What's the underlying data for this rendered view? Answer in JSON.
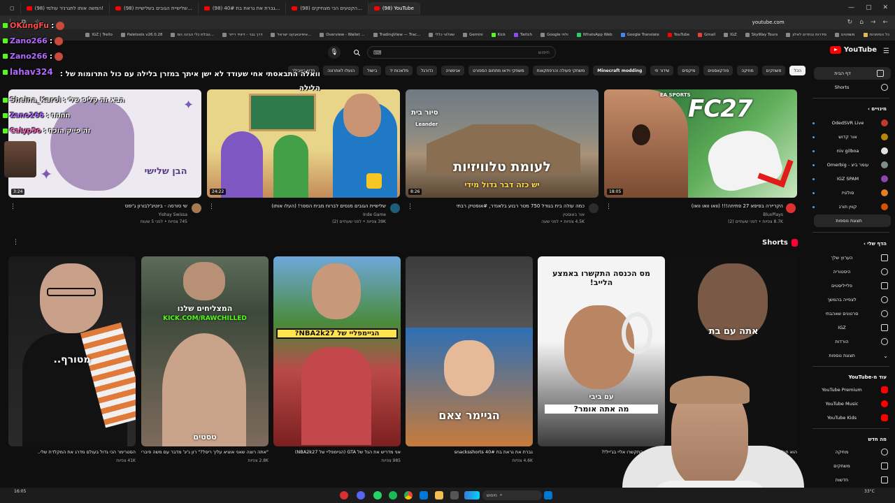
{
  "browser": {
    "tabs": [
      {
        "label": "(98) YouTube",
        "active": true
      },
      {
        "label": "(98) הקטעים הכי מצחיקים...",
        "active": false
      },
      {
        "label": "(98) גברת את גראת בת 40#...",
        "active": false
      },
      {
        "label": "(98) שלישיית הגובים בשלישיית...",
        "active": false
      },
      {
        "label": "(98) המשה אותו לתגרניר עולמי!",
        "active": false
      }
    ],
    "url": "youtube.com",
    "bookmarks": [
      "IGZ | Trello",
      "Paletools v26.0.28",
      "טבלת כלי הבינה המ...",
      "דרך גבר - דיוויד רייזר",
      "איפיונאגקט ישראל...",
      "Overview - Wallet ...",
      "TradingView — Trac...",
      "שאלוני כללי",
      "Gemini",
      "Kick",
      "Twitch",
      "Google ולתי",
      "WhatsApp Web",
      "Google Translate",
      "YouTube",
      "Gmail",
      "IGZ",
      "SkyWay Tours",
      "סידרות ובחדים לאלון",
      "משפטים",
      "כל הסימניות"
    ]
  },
  "header": {
    "search_placeholder": "חיפוש",
    "logo_text": "YouTube"
  },
  "chips": [
    "הכל",
    "משחקים",
    "מוזיקה",
    "פודקאסטים",
    "מיקסים",
    "שידור חי",
    "Minecraft modding",
    "משחקי פעולה והרפתקאות",
    "משחקי וידאו מתחום הספורט",
    "אנימציה",
    "כדורגל",
    "מלאכות יד",
    "בישול",
    "הועלו לאחרונה",
    "חדש בשבילך"
  ],
  "sidebar": {
    "main": [
      {
        "label": "דף הבית",
        "icon": "home-icon"
      },
      {
        "label": "Shorts",
        "icon": "shorts-icon"
      }
    ],
    "subscriptions_title": "מינויים",
    "subscriptions": [
      {
        "label": "OdedSVR Live",
        "color": "#c0392b",
        "live": true
      },
      {
        "label": "אור קדוש",
        "color": "#b8860b",
        "live": true
      },
      {
        "label": "niv gilboa",
        "color": "#e0e0e0",
        "live": true
      },
      {
        "label": "עומר ביצ - Omerbig",
        "color": "#7f8c8d",
        "live": true
      },
      {
        "label": "IGZ SPAM",
        "color": "#8e44ad",
        "live": true
      },
      {
        "label": "סולטיז",
        "color": "#e67e22",
        "live": true
      },
      {
        "label": "קווין תורג",
        "color": "#d35400",
        "live": true
      }
    ],
    "show_more_subs": "תצוגת נוספות",
    "you_title": "הדף שלי",
    "you_items": [
      {
        "label": "הערוץ שלך",
        "icon": "channel-icon"
      },
      {
        "label": "היסטוריה",
        "icon": "history-icon"
      },
      {
        "label": "פלייליסטים",
        "icon": "playlists-icon"
      },
      {
        "label": "לצפייה בהמשך",
        "icon": "watch-later-icon"
      },
      {
        "label": "סרטונים שאהבתי",
        "icon": "like-icon"
      },
      {
        "label": "IGZ",
        "icon": "playlist-icon"
      },
      {
        "label": "הורדות",
        "icon": "download-icon"
      },
      {
        "label": "תצוגת נוספות",
        "icon": "chevron-down-icon"
      }
    ],
    "more_title": "עוד מ-YouTube",
    "more_items": [
      {
        "label": "YouTube Premium"
      },
      {
        "label": "YouTube Music"
      },
      {
        "label": "YouTube Kids"
      }
    ],
    "explore_title": "מה חדש",
    "explore_items": [
      {
        "label": "מוזיקה"
      },
      {
        "label": "משחקים"
      },
      {
        "label": "חדשות"
      }
    ]
  },
  "videos": [
    {
      "title": "הקריירה בפיפא 27 פתיחה!!! (וואו וואו וואו)",
      "channel": "BluxPlays",
      "meta": "8.7K צפיות • לפני שעתיים (2)",
      "duration": "18:05",
      "overlay": "FC27",
      "overlay_small": "EA SPORTS"
    },
    {
      "title": "כמה עולה בית בגודל 750 מטר רבוע בלאנדר, #אופטיק רבתי",
      "channel": "אור באוסטין",
      "meta": "4.5K צפיות • לפני שעה",
      "duration": "8:26",
      "overlay": "לעומת טלוויזיות",
      "overlay2": "יש כזה דבר גדול מידי",
      "overlay3": "סיור בית",
      "overlay4": "Leander"
    },
    {
      "title": "שלישיית הגובים מנסים לברוח מבית הספר! (העלו אותו)",
      "channel": "Inde Game",
      "meta": "39K צפיות • לפני שעתיים (2)",
      "duration": "24:22"
    },
    {
      "title": "שי סורסה - ביוטיג'לבורון ג'ימס",
      "channel": "Yishay Swissa",
      "meta": "745 צפיות • לפני 5 שעות",
      "duration": "3:24",
      "overlay": "הבן שלישי"
    }
  ],
  "shorts": {
    "title": "Shorts",
    "items": [
      {
        "title": "הוא חולם...",
        "views": "",
        "overlay": "אתה עם בת"
      },
      {
        "title": "מס הכנסה התקשרו אליי בג'ייל!?",
        "views": "צפיות",
        "overlay": "מס הכנסה התקשרו באמצע הלייב!",
        "overlay2": "מה אתה אומר?",
        "overlay3": "עם ביבי"
      },
      {
        "title": "גברת את גראת בת 40# snacksshorts",
        "views": "4.6K צפיות",
        "overlay": "הגיימר צאם"
      },
      {
        "title": "אני מדריש את הגל של GTA (הגיימפליי של NBA2k27)",
        "views": "985 צפיות",
        "overlay": "הגיימפליי של NBA2k27?"
      },
      {
        "title": "\"אתה רוצה שאני אוציא עליך ריסל?\" רון ג'יג' מדבר עם משה פיבריקנט ובנוב לאמיר פיטינגר שבליינ",
        "views": "2.8K צפיות",
        "overlay": "המצליחים שלנו",
        "overlay2": "KICK.COM/RAWCHILLED",
        "overlay3": "טסטים"
      },
      {
        "title": "הסטרימר הכי גדול בעולם מדרג את המקלדת שלי..",
        "views": "41K צפיות",
        "overlay": "מטורף.."
      }
    ]
  },
  "chat": [
    {
      "user": "OKungFu",
      "msg": "",
      "color": "#ff4d4d"
    },
    {
      "user": "Zano266",
      "msg": "",
      "color": "#b26bff"
    },
    {
      "user": "Zano266",
      "msg": "",
      "color": "#b26bff"
    },
    {
      "user": "lahav324",
      "msg": "וואלה התבאסתי אחי שעודד לא ישן איתך במזרן בלילה עם כול התרומות של : הלילה",
      "color": "#b26bff"
    },
    {
      "user": "Sheina_Karol",
      "msg": "הבא זה קליפ שלי",
      "color": "#d9d9d9"
    },
    {
      "user": "Zano266",
      "msg": "חחחח",
      "color": "#b26bff"
    },
    {
      "user": "Calyp5o",
      "msg": "זה פייק הוכח",
      "color": "#ff66c4"
    }
  ],
  "taskbar": {
    "search_placeholder": "חיפוש",
    "weather": "33°C",
    "time": "16:05"
  },
  "colors": {
    "accent": "#ff0000",
    "kick_green": "#53fc18",
    "bg": "#0f0f0f",
    "chip_bg": "#272727"
  }
}
